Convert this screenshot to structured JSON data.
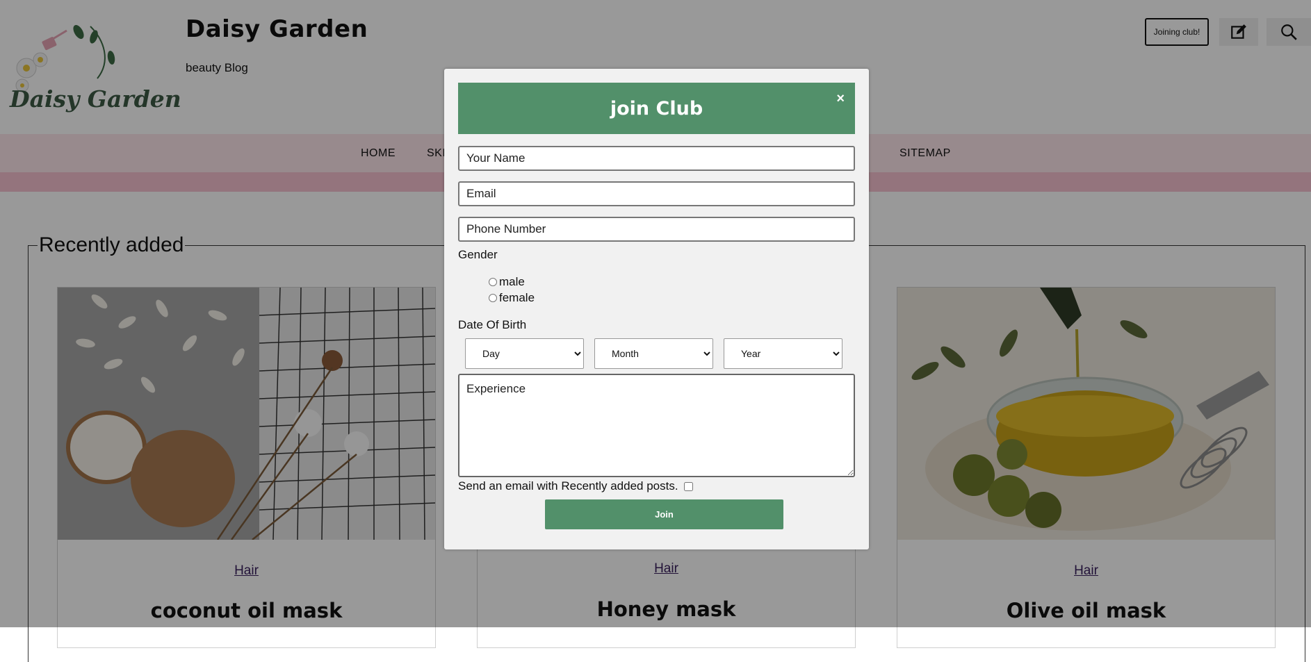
{
  "site": {
    "title": "Daisy Garden",
    "tagline": "beauty Blog",
    "logo_text": "Daisy Garden",
    "join_button": "Joining club!"
  },
  "nav": {
    "items": [
      "HOME",
      "SKI",
      "SITEMAP"
    ]
  },
  "section": {
    "legend": "Recently added"
  },
  "cards": [
    {
      "category": "Hair",
      "title": "coconut oil mask",
      "image": "coconut-photo"
    },
    {
      "category": "Hair",
      "title": "Honey mask",
      "image": "honey-photo"
    },
    {
      "category": "Hair",
      "title": "Olive oil mask",
      "image": "olive-oil-photo"
    }
  ],
  "modal": {
    "title": "join Club",
    "close": "×",
    "name_placeholder": "Your Name",
    "email_placeholder": "Email",
    "phone_placeholder": "Phone Number",
    "gender_label": "Gender",
    "gender_options": [
      "male",
      "female"
    ],
    "dob_label": "Date Of Birth",
    "day": "Day",
    "month": "Month",
    "year": "Year",
    "experience_placeholder": "Experience",
    "newsletter_label": "Send an email with Recently added posts.",
    "join_label": "Join"
  },
  "colors": {
    "modal_accent": "#52906a",
    "nav_bg": "#fde6ec",
    "nav_stripe": "#f7c2d0",
    "category_link": "#3a1f5e"
  }
}
